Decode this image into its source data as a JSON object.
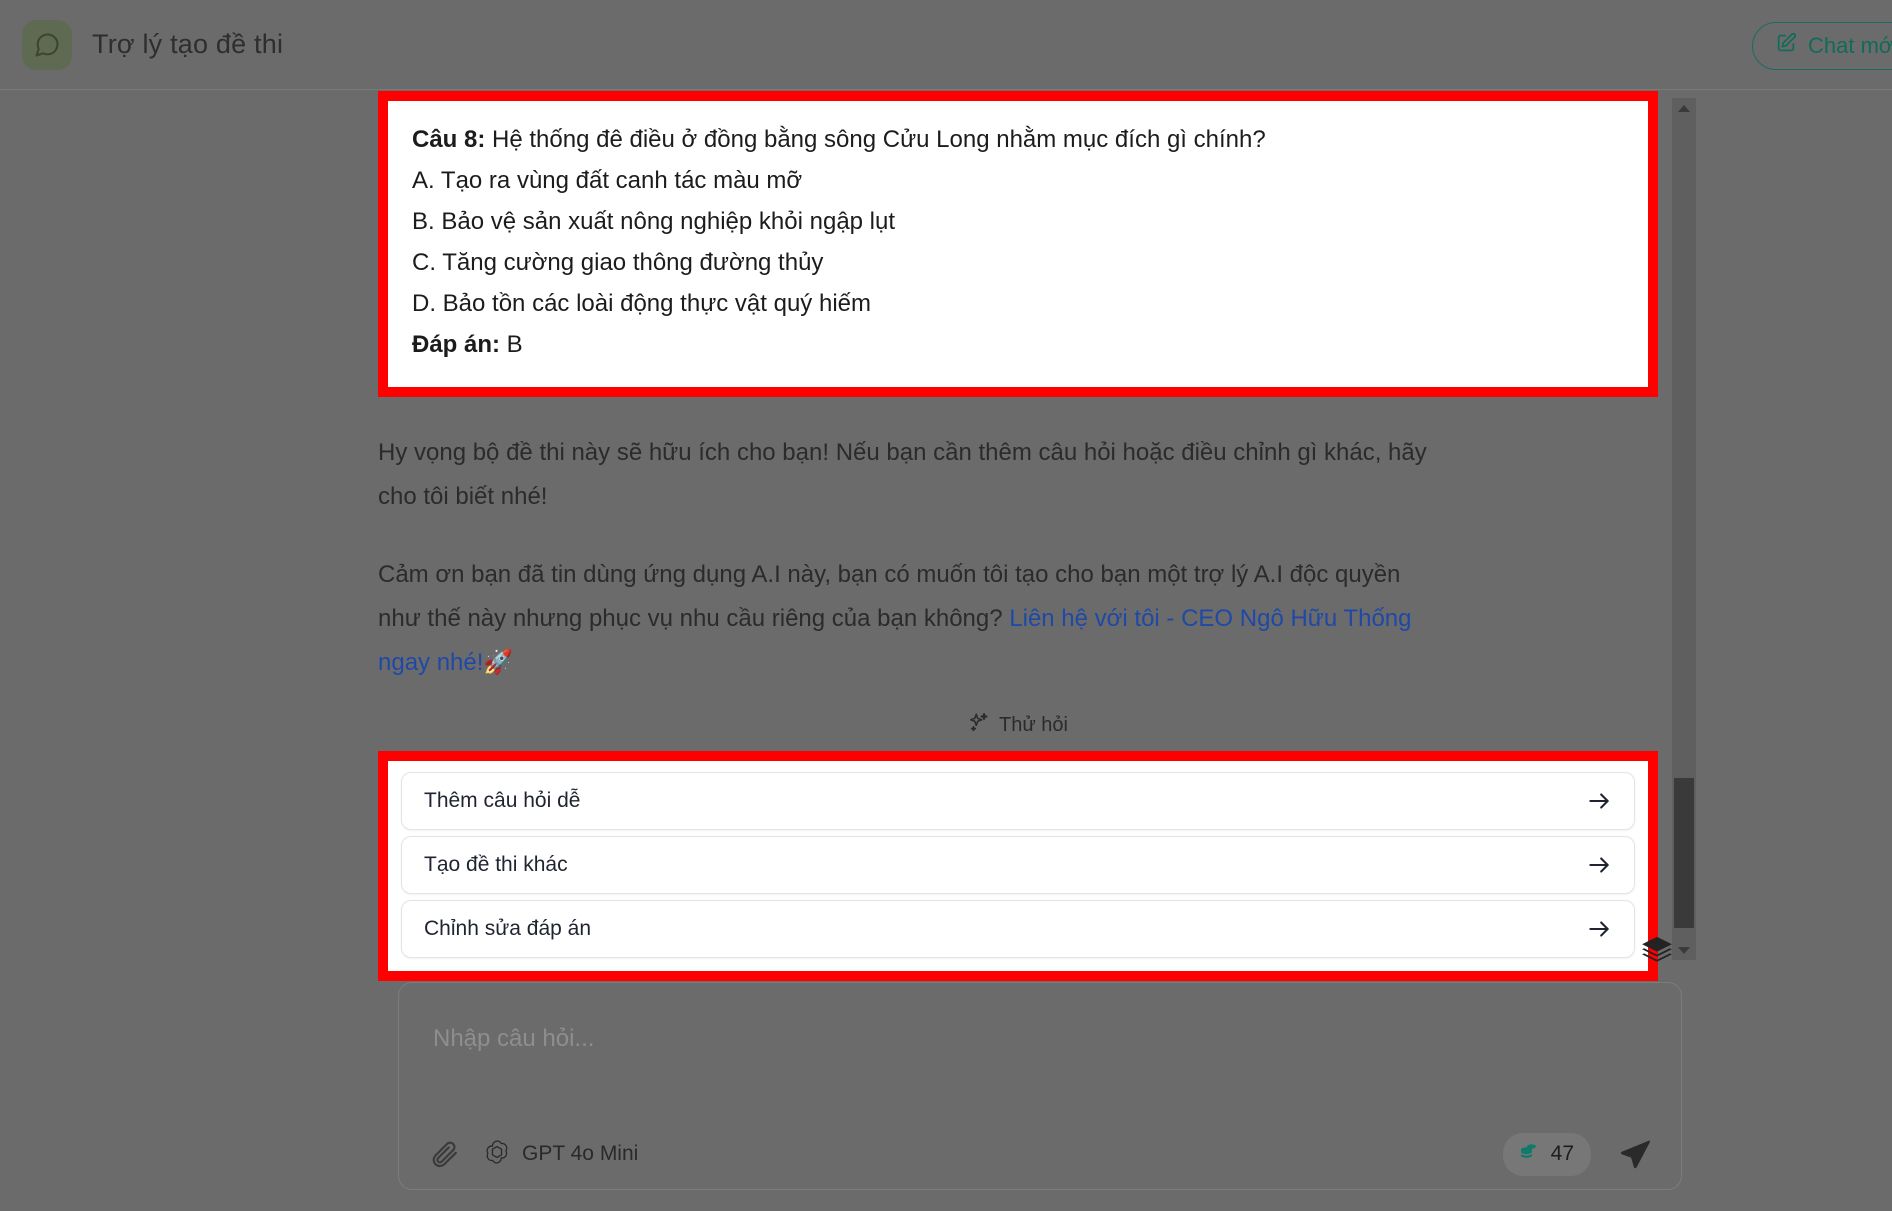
{
  "header": {
    "avatar_icon": "chat-bubble-icon",
    "title": "Trợ lý tạo đề thi",
    "new_chat_label": "Chat mới",
    "new_chat_icon": "edit-square-icon",
    "accent_color": "#126b59",
    "avatar_bg": "#5e6b52"
  },
  "conversation": {
    "question_block": {
      "highlight_color": "#ff0000",
      "lines": [
        {
          "bold": "Câu 8:",
          "rest": " Hệ thống đê điều ở đồng bằng sông Cửu Long nhằm mục đích gì chính?"
        },
        {
          "bold": "",
          "rest": "A. Tạo ra vùng đất canh tác màu mỡ"
        },
        {
          "bold": "",
          "rest": "B. Bảo vệ sản xuất nông nghiệp khỏi ngập lụt"
        },
        {
          "bold": "",
          "rest": "C. Tăng cường giao thông đường thủy"
        },
        {
          "bold": "",
          "rest": "D. Bảo tồn các loài động thực vật quý hiếm"
        },
        {
          "bold": "Đáp án:",
          "rest": " B"
        }
      ]
    },
    "paragraph_1": "Hy vọng bộ đề thi này sẽ hữu ích cho bạn! Nếu bạn cần thêm câu hỏi hoặc điều chỉnh gì khác, hãy cho tôi biết nhé!",
    "paragraph_2_pre": "Cảm ơn bạn đã tin dùng ứng dụng A.I này, bạn có muốn tôi tạo cho bạn một trợ lý A.I độc quyền như thế này nhưng phục vụ nhu cầu riêng của bạn không? ",
    "paragraph_2_link": "Liên hệ với tôi - CEO Ngô Hữu Thống ngay nhé!",
    "paragraph_2_emoji": "🚀",
    "link_color": "#1f49a6"
  },
  "suggestions": {
    "section_label": "Thử hỏi",
    "section_icon": "sparkles-icon",
    "highlight_color": "#ff0000",
    "items": [
      {
        "label": "Thêm câu hỏi dễ",
        "icon": "arrow-right-icon"
      },
      {
        "label": "Tạo đề thi khác",
        "icon": "arrow-right-icon"
      },
      {
        "label": "Chỉnh sửa đáp án",
        "icon": "arrow-right-icon"
      }
    ]
  },
  "side": {
    "layers_icon": "layers-icon",
    "scrollbar_up_icon": "scroll-up-arrow-icon",
    "scrollbar_down_icon": "scroll-down-arrow-icon"
  },
  "composer": {
    "placeholder": "Nhập câu hỏi...",
    "attach_icon": "paperclip-icon",
    "model_icon": "openai-logo-icon",
    "model_name": "GPT 4o Mini",
    "credits_icon": "coins-icon",
    "credits_count": "47",
    "credits_color": "#0f7a68",
    "send_icon": "send-paper-plane-icon"
  }
}
